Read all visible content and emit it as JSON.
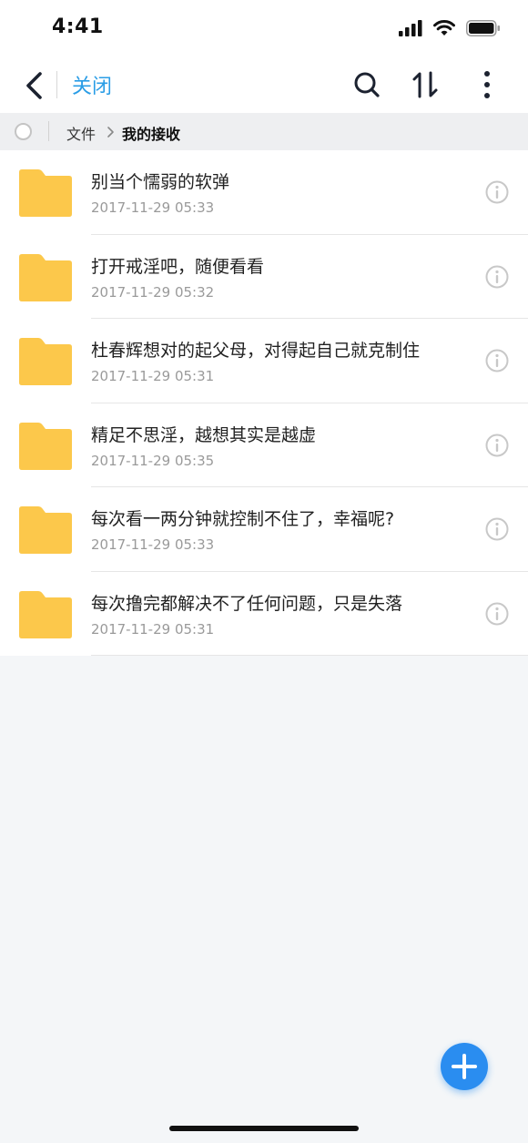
{
  "status_bar": {
    "time": "4:41"
  },
  "header": {
    "close_label": "关闭"
  },
  "breadcrumb": {
    "root": "文件",
    "current": "我的接收"
  },
  "files": [
    {
      "name": "别当个懦弱的软弹",
      "date": "2017-11-29 05:33",
      "icon": "folder-icon"
    },
    {
      "name": "打开戒淫吧，随便看看",
      "date": "2017-11-29 05:32",
      "icon": "folder-icon"
    },
    {
      "name": "杜春辉想对的起父母，对得起自己就克制住",
      "date": "2017-11-29 05:31",
      "icon": "folder-icon"
    },
    {
      "name": "精足不思淫，越想其实是越虚",
      "date": "2017-11-29 05:35",
      "icon": "folder-icon"
    },
    {
      "name": "每次看一两分钟就控制不住了，幸福呢?",
      "date": "2017-11-29 05:33",
      "icon": "folder-icon"
    },
    {
      "name": "每次撸完都解决不了任何问题，只是失落",
      "date": "2017-11-29 05:31",
      "icon": "folder-icon"
    }
  ],
  "colors": {
    "accent": "#2a9de6",
    "folder": "#fcc84b",
    "fab": "#2a8df0"
  }
}
